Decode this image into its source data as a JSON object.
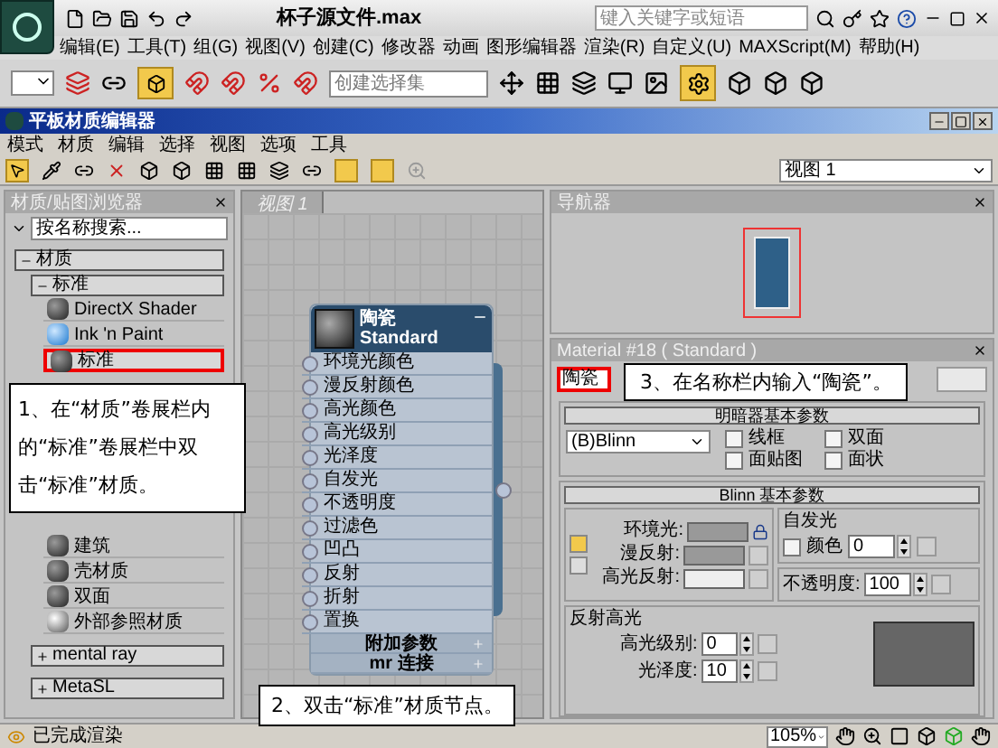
{
  "app": {
    "title": "杯子源文件.max",
    "search_placeholder": "键入关键字或短语",
    "menus": [
      "编辑(E)",
      "工具(T)",
      "组(G)",
      "视图(V)",
      "创建(C)",
      "修改器",
      "动画",
      "图形编辑器",
      "渲染(R)",
      "自定义(U)",
      "MAXScript(M)",
      "帮助(H)"
    ],
    "selection_set_placeholder": "创建选择集"
  },
  "editor": {
    "title": "平板材质编辑器",
    "menus": [
      "模式",
      "材质",
      "编辑",
      "选择",
      "视图",
      "选项",
      "工具"
    ],
    "view_select": "视图 1"
  },
  "browser": {
    "title": "材质/贴图浏览器",
    "search_placeholder": "按名称搜索...",
    "groups": [
      {
        "label": "材质",
        "expanded": true,
        "children": [
          {
            "label": "标准",
            "expanded": true,
            "items": [
              {
                "name": "DirectX Shader",
                "kind": "dark",
                "selected": false
              },
              {
                "name": "Ink 'n Paint",
                "kind": "blue",
                "selected": false
              },
              {
                "name": "标准",
                "kind": "dark",
                "selected": true
              },
              {
                "name": "建筑",
                "kind": "dark",
                "selected": false
              },
              {
                "name": "壳材质",
                "kind": "dark",
                "selected": false
              },
              {
                "name": "双面",
                "kind": "dark",
                "selected": false
              },
              {
                "name": "外部参照材质",
                "kind": "chrome",
                "selected": false
              }
            ]
          },
          {
            "label": "mental ray",
            "expanded": false
          },
          {
            "label": "MetaSL",
            "expanded": false
          }
        ]
      }
    ]
  },
  "view": {
    "tab": "视图 1",
    "node": {
      "name": "陶瓷",
      "type": "Standard",
      "slots": [
        "环境光颜色",
        "漫反射颜色",
        "高光颜色",
        "高光级别",
        "光泽度",
        "自发光",
        "不透明度",
        "过滤色",
        "凹凸",
        "反射",
        "折射",
        "置换"
      ],
      "rollouts": [
        "附加参数",
        "mr 连接"
      ]
    }
  },
  "navigator": {
    "title": "导航器"
  },
  "params": {
    "title": "Material #18 ( Standard )",
    "name": "陶瓷",
    "shader_rollout": "明暗器基本参数",
    "shader": "(B)Blinn",
    "options": [
      {
        "label": "线框",
        "checked": false
      },
      {
        "label": "双面",
        "checked": false
      },
      {
        "label": "面贴图",
        "checked": false
      },
      {
        "label": "面状",
        "checked": false
      }
    ],
    "blinn_rollout": "Blinn 基本参数",
    "color_labels": [
      "环境光:",
      "漫反射:",
      "高光反射:"
    ],
    "self_illum": {
      "title": "自发光",
      "color_label": "颜色",
      "checked": false,
      "value": "0"
    },
    "opacity": {
      "label": "不透明度:",
      "value": "100"
    },
    "highlights": {
      "title": "反射高光",
      "level_label": "高光级别:",
      "level_value": "0",
      "gloss_label": "光泽度:",
      "gloss_value": "10"
    }
  },
  "status": {
    "text": "已完成渲染",
    "zoom": "105%"
  },
  "callouts": [
    "1、在“材质”卷展栏内的“标准”卷展栏中双击“标准”材质。",
    "2、双击“标准”材质节点。",
    "3、在名称栏内输入“陶瓷”。"
  ]
}
